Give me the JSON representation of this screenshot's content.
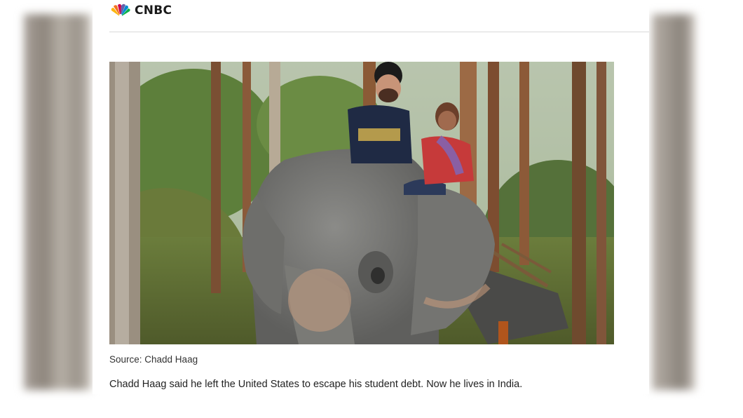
{
  "brand": {
    "name": "CNBC",
    "logo_icon": "nbc-peacock-icon",
    "peacock_colors": [
      "#f37021",
      "#fcb711",
      "#6460aa",
      "#0089d0",
      "#0db14b",
      "#cc004c"
    ]
  },
  "article": {
    "image_alt": "elephant-ride-photo",
    "source": "Source: Chadd Haag",
    "caption": "Chadd Haag said he left the United States to escape his student debt. Now he lives in India."
  }
}
